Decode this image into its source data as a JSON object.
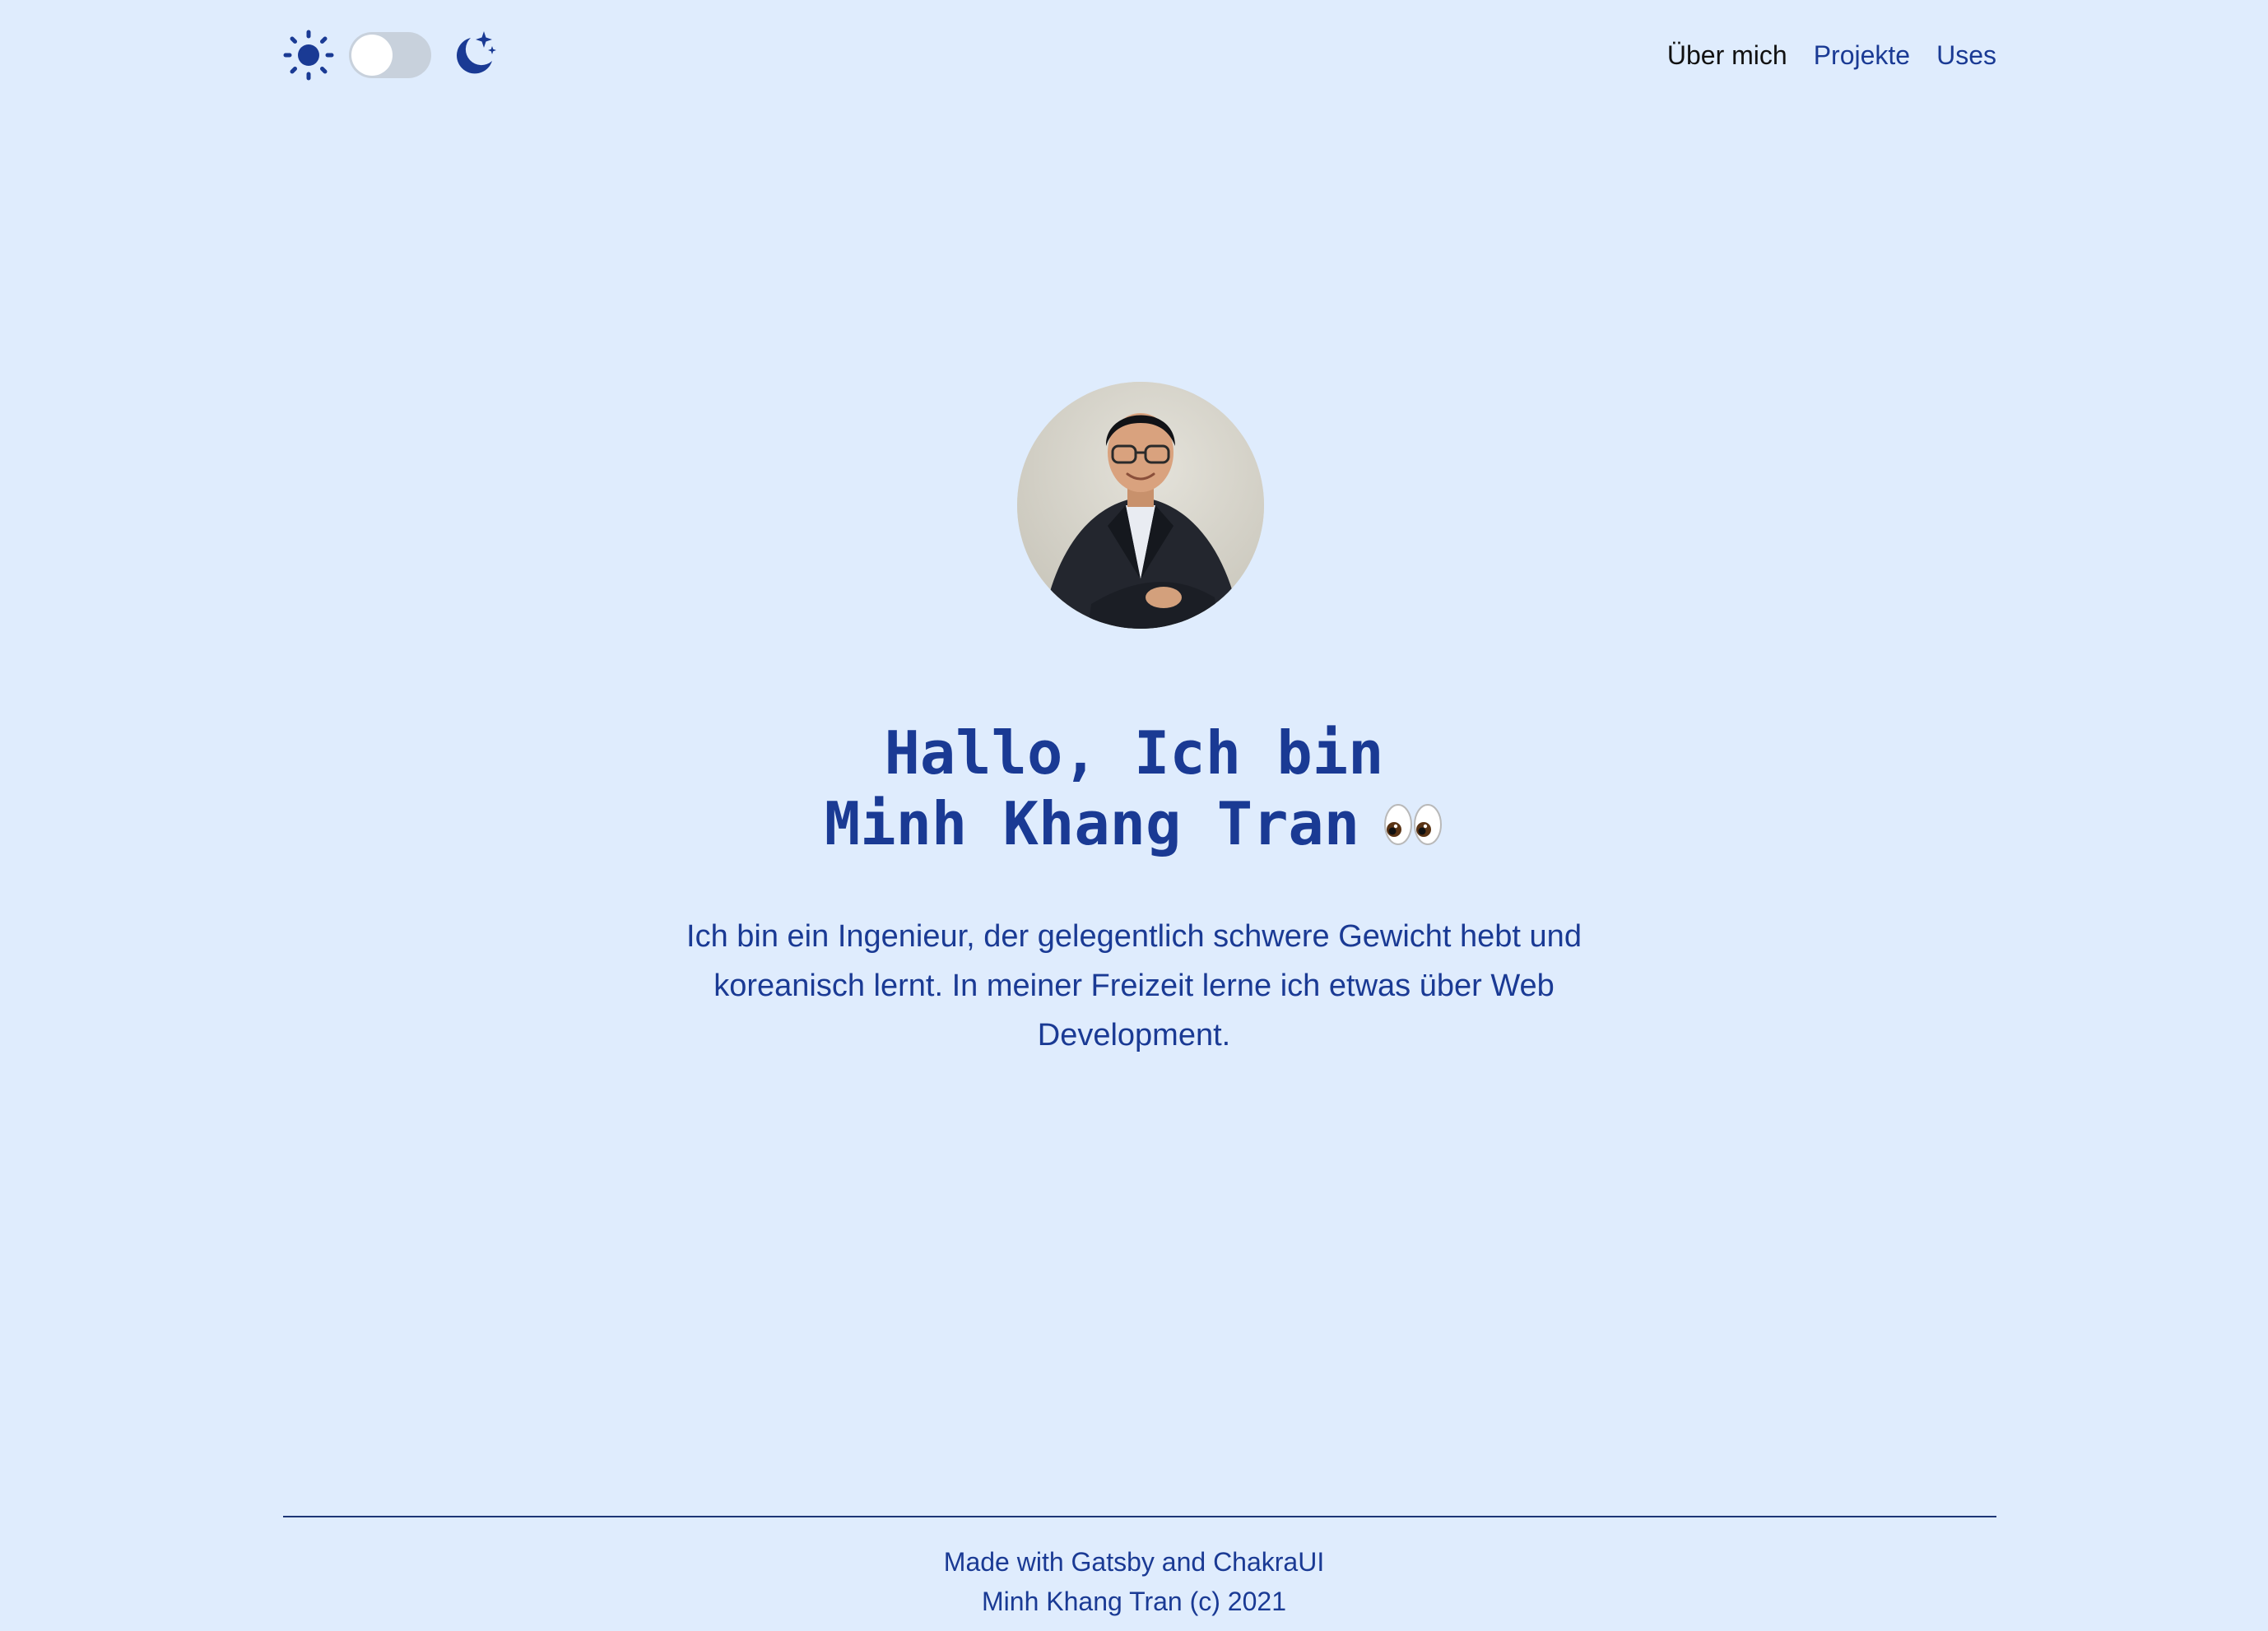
{
  "header": {
    "theme_toggle": {
      "light_icon": "sun-icon",
      "dark_icon": "moon-stars-icon",
      "state": "light"
    },
    "nav": [
      {
        "label": "Über mich",
        "active": true
      },
      {
        "label": "Projekte",
        "active": false
      },
      {
        "label": "Uses",
        "active": false
      }
    ]
  },
  "hero": {
    "avatar_alt": "Portrait photo",
    "title_line1": "Hallo, Ich bin",
    "title_line2": "Minh Khang Tran",
    "title_emoji_icon": "eyes-icon",
    "intro": "Ich bin ein Ingenieur, der gelegentlich schwere Gewicht hebt und koreanisch lernt. In meiner Freizeit lerne ich etwas über Web Development."
  },
  "footer": {
    "line1": "Made with Gatsby and ChakraUI",
    "line2": "Minh Khang Tran (c) 2021"
  },
  "colors": {
    "background": "#dfecfd",
    "primary_text": "#1a3a94",
    "active_nav": "#111111",
    "switch_track": "#c8d1dc"
  }
}
